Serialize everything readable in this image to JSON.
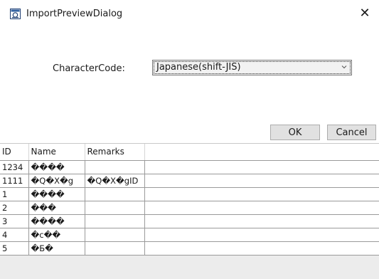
{
  "window": {
    "title": "ImportPreviewDialog",
    "icon": "app-window-icon",
    "close_glyph": "✕"
  },
  "form": {
    "character_code_label": "CharacterCode:",
    "character_code_value": "Japanese(shift-JIS)"
  },
  "buttons": {
    "ok_label": "OK",
    "cancel_label": "Cancel"
  },
  "grid": {
    "columns": [
      "ID",
      "Name",
      "Remarks"
    ],
    "rows": [
      {
        "id": "1234",
        "name": "����",
        "remarks": ""
      },
      {
        "id": "1111",
        "name": "�Q�X�g",
        "remarks": "�Q�X�gID"
      },
      {
        "id": "1",
        "name": "����",
        "remarks": ""
      },
      {
        "id": "2",
        "name": "���",
        "remarks": ""
      },
      {
        "id": "3",
        "name": "����",
        "remarks": ""
      },
      {
        "id": "4",
        "name": "�c��",
        "remarks": ""
      },
      {
        "id": "5",
        "name": "�Б�",
        "remarks": ""
      }
    ]
  }
}
